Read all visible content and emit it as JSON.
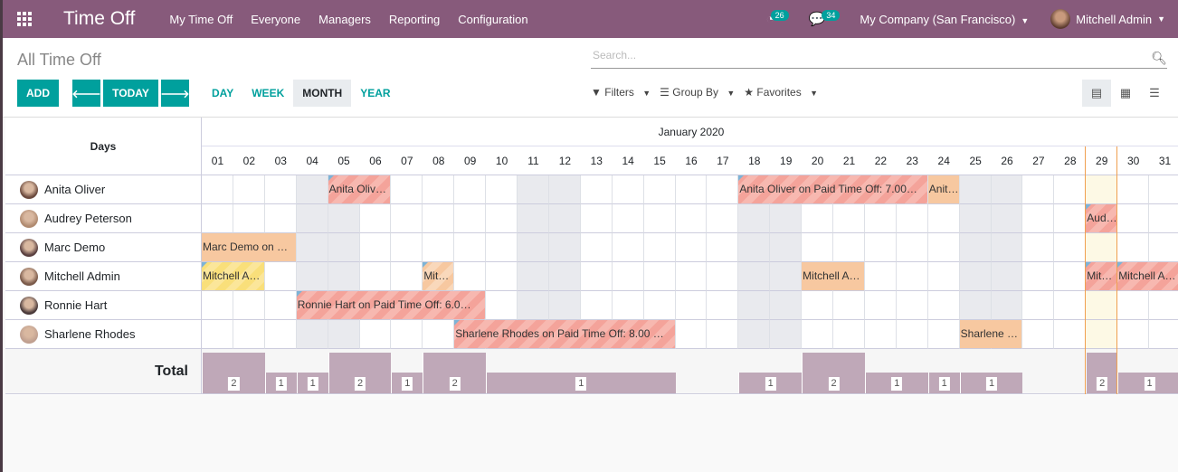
{
  "nav": {
    "app_title": "Time Off",
    "menu": [
      "My Time Off",
      "Everyone",
      "Managers",
      "Reporting",
      "Configuration"
    ],
    "activity_count": "26",
    "message_count": "34",
    "company": "My Company (San Francisco)",
    "user": "Mitchell Admin"
  },
  "control": {
    "title": "All Time Off",
    "search_placeholder": "Search...",
    "add": "ADD",
    "today": "TODAY",
    "scales": [
      "DAY",
      "WEEK",
      "MONTH",
      "YEAR"
    ],
    "active_scale": "MONTH",
    "filters": "Filters",
    "group_by": "Group By",
    "favorites": "Favorites",
    "views": [
      "gantt-icon",
      "calendar-icon",
      "list-icon"
    ],
    "active_view": "gantt-icon"
  },
  "gantt": {
    "row_header": "Days",
    "month": "January 2020",
    "days": [
      "01",
      "02",
      "03",
      "04",
      "05",
      "06",
      "07",
      "08",
      "09",
      "10",
      "11",
      "12",
      "13",
      "14",
      "15",
      "16",
      "17",
      "18",
      "19",
      "20",
      "21",
      "22",
      "23",
      "24",
      "25",
      "26",
      "27",
      "28",
      "29",
      "30",
      "31"
    ],
    "weekends": [
      4,
      5,
      11,
      12,
      18,
      19,
      25,
      26
    ],
    "today": 29,
    "rows": [
      {
        "name": "Anita Oliver",
        "avatar": "#6b4a3e",
        "pills": [
          {
            "start": 5,
            "end": 6,
            "label": "Anita Oliv…",
            "style": "red",
            "corner": true
          },
          {
            "start": 18,
            "end": 23,
            "label": "Anita Oliver on Paid Time Off: 7.00…",
            "style": "red",
            "corner": true
          },
          {
            "start": 24,
            "end": 24,
            "label": "Anit…",
            "style": "orange",
            "corner": false
          }
        ]
      },
      {
        "name": "Audrey Peterson",
        "avatar": "#b08a70",
        "pills": [
          {
            "start": 29,
            "end": 29,
            "label": "Aud…",
            "style": "red",
            "corner": true
          }
        ]
      },
      {
        "name": "Marc Demo",
        "avatar": "#5a4040",
        "pills": [
          {
            "start": 1,
            "end": 3,
            "label": "Marc Demo on …",
            "style": "orange",
            "corner": false
          }
        ]
      },
      {
        "name": "Mitchell Admin",
        "avatar": "#7a5a4a",
        "pills": [
          {
            "start": 1,
            "end": 2,
            "label": "Mitchell A…",
            "style": "yellow",
            "corner": true
          },
          {
            "start": 8,
            "end": 8,
            "label": "Mit…",
            "style": "lorange",
            "corner": true
          },
          {
            "start": 20,
            "end": 21,
            "label": "Mitchell A…",
            "style": "orange",
            "corner": false
          },
          {
            "start": 29,
            "end": 29,
            "label": "Mit…",
            "style": "red",
            "corner": true
          },
          {
            "start": 30,
            "end": 31,
            "label": "Mitchell A…",
            "style": "red",
            "corner": true
          }
        ]
      },
      {
        "name": "Ronnie Hart",
        "avatar": "#4a3a3a",
        "pills": [
          {
            "start": 4,
            "end": 9,
            "label": "Ronnie Hart on Paid Time Off: 6.0…",
            "style": "red",
            "corner": true
          }
        ]
      },
      {
        "name": "Sharlene Rhodes",
        "avatar": "#c0a090",
        "pills": [
          {
            "start": 9,
            "end": 15,
            "label": "Sharlene Rhodes on Paid Time Off: 8.00 …",
            "style": "red",
            "corner": true
          },
          {
            "start": 25,
            "end": 26,
            "label": "Sharlene …",
            "style": "orange",
            "corner": false
          }
        ]
      }
    ],
    "total_label": "Total",
    "totals": [
      {
        "start": 1,
        "end": 2,
        "value": 2
      },
      {
        "start": 3,
        "end": 3,
        "value": 1
      },
      {
        "start": 4,
        "end": 4,
        "value": 1
      },
      {
        "start": 5,
        "end": 6,
        "value": 2
      },
      {
        "start": 7,
        "end": 7,
        "value": 1
      },
      {
        "start": 8,
        "end": 9,
        "value": 2
      },
      {
        "start": 10,
        "end": 15,
        "value": 1
      },
      {
        "start": 18,
        "end": 19,
        "value": 1
      },
      {
        "start": 20,
        "end": 21,
        "value": 2
      },
      {
        "start": 22,
        "end": 23,
        "value": 1
      },
      {
        "start": 24,
        "end": 24,
        "value": 1
      },
      {
        "start": 25,
        "end": 26,
        "value": 1
      },
      {
        "start": 29,
        "end": 29,
        "value": 2
      },
      {
        "start": 30,
        "end": 31,
        "value": 1
      }
    ]
  }
}
